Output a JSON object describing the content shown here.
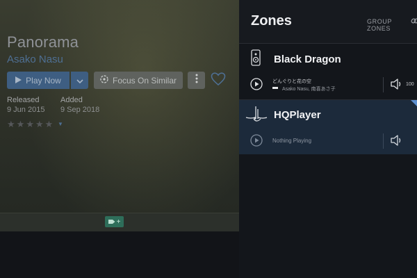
{
  "album": {
    "title": "Panorama",
    "artist": "Asako Nasu",
    "play_now_label": "Play Now",
    "focus_label": "Focus On Similar",
    "released_label": "Released",
    "released_value": "9 Jun 2015",
    "added_label": "Added",
    "added_value": "9 Sep 2018",
    "rating_stars": 5,
    "rating_value": 0
  },
  "tagbar": {
    "tag_plus": "+"
  },
  "zones": {
    "title": "Zones",
    "group_zones_label": "GROUP ZONES",
    "items": [
      {
        "name": "Black Dragon",
        "track_title": "どんぐりと花の空",
        "track_artist": "Asako Nasu, 南喜あさ子",
        "volume": "100",
        "selected": false
      },
      {
        "name": "HQPlayer",
        "status": "Nothing Playing",
        "selected": true
      }
    ]
  },
  "colors": {
    "accent": "#3e5e82",
    "selected_zone_bg": "#1c2a3b",
    "panel_bg": "#13161b",
    "tag_green": "#2e6e5a"
  },
  "icons": [
    "play-icon",
    "chevron-down-icon",
    "focus-icon",
    "more-vertical-icon",
    "heart-icon",
    "star-icon",
    "tag-icon",
    "link-icon",
    "speaker-device-icon",
    "hqplayer-logo-icon",
    "volume-icon"
  ]
}
